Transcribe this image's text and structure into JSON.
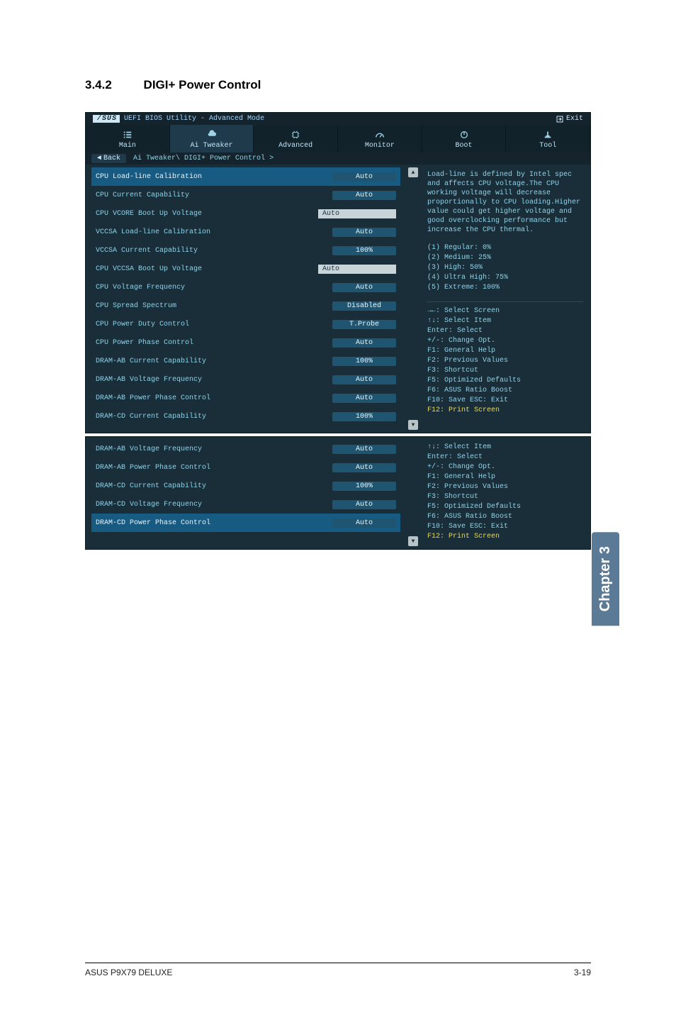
{
  "section": {
    "number": "3.4.2",
    "title": "DIGI+ Power Control"
  },
  "bios": {
    "title_brand": "/SUS",
    "title_rest": "UEFI BIOS Utility - Advanced Mode",
    "exit_label": "Exit",
    "tabs": [
      {
        "label": "Main",
        "icon": "list-icon"
      },
      {
        "label": "Ai Tweaker",
        "icon": "cloud-icon"
      },
      {
        "label": "Advanced",
        "icon": "chip-icon"
      },
      {
        "label": "Monitor",
        "icon": "gauge-icon"
      },
      {
        "label": "Boot",
        "icon": "power-icon"
      },
      {
        "label": "Tool",
        "icon": "tool-icon"
      }
    ],
    "back_label": "Back",
    "breadcrumb": "Ai Tweaker\\ DIGI+ Power Control >",
    "rows_top": [
      {
        "label": "CPU Load-line Calibration",
        "value": "Auto",
        "type": "btn",
        "selected": true
      },
      {
        "label": "CPU Current Capability",
        "value": "Auto",
        "type": "btn"
      },
      {
        "label": "CPU VCORE Boot Up Voltage",
        "value": "Auto",
        "type": "input"
      },
      {
        "label": "VCCSA Load-line Calibration",
        "value": "Auto",
        "type": "btn"
      },
      {
        "label": "VCCSA Current Capability",
        "value": "100%",
        "type": "btn"
      },
      {
        "label": "CPU VCCSA Boot Up Voltage",
        "value": "Auto",
        "type": "input"
      },
      {
        "label": "CPU Voltage Frequency",
        "value": "Auto",
        "type": "btn"
      },
      {
        "label": "CPU Spread Spectrum",
        "value": "Disabled",
        "type": "btn"
      },
      {
        "label": "CPU Power Duty Control",
        "value": "T.Probe",
        "type": "btn"
      },
      {
        "label": "CPU Power Phase Control",
        "value": "Auto",
        "type": "btn"
      },
      {
        "label": "DRAM-AB Current Capability",
        "value": "100%",
        "type": "btn"
      },
      {
        "label": "DRAM-AB Voltage Frequency",
        "value": "Auto",
        "type": "btn"
      },
      {
        "label": "DRAM-AB Power Phase Control",
        "value": "Auto",
        "type": "btn"
      },
      {
        "label": "DRAM-CD Current Capability",
        "value": "100%",
        "type": "btn"
      }
    ],
    "help_top": "Load-line is defined by Intel spec and affects CPU voltage.The CPU working voltage will decrease proportionally to CPU loading.Higher value could get higher voltage and good overclocking performance but increase the CPU thermal.",
    "help_list": [
      "(1) Regular: 0%",
      "(2) Medium: 25%",
      "(3) High: 50%",
      "(4) Ultra High: 75%",
      "(5) Extreme: 100%"
    ],
    "keys_top": [
      "→←: Select Screen",
      "↑↓: Select Item",
      "Enter: Select",
      "+/-: Change Opt.",
      "F1: General Help",
      "F2: Previous Values",
      "F3: Shortcut",
      "F5: Optimized Defaults",
      "F6: ASUS Ratio Boost",
      "F10: Save  ESC: Exit"
    ],
    "keys_top_highlight": "F12: Print Screen",
    "rows_bottom": [
      {
        "label": "DRAM-AB Voltage Frequency",
        "value": "Auto",
        "type": "btn"
      },
      {
        "label": "DRAM-AB Power Phase Control",
        "value": "Auto",
        "type": "btn"
      },
      {
        "label": "DRAM-CD Current Capability",
        "value": "100%",
        "type": "btn"
      },
      {
        "label": "DRAM-CD Voltage Frequency",
        "value": "Auto",
        "type": "btn"
      },
      {
        "label": "DRAM-CD Power Phase Control",
        "value": "Auto",
        "type": "btn",
        "selected": true
      }
    ],
    "keys_bottom": [
      "↑↓: Select Item",
      "Enter: Select",
      "+/-: Change Opt.",
      "F1: General Help",
      "F2: Previous Values",
      "F3: Shortcut",
      "F5: Optimized Defaults",
      "F6: ASUS Ratio Boost",
      "F10: Save  ESC: Exit"
    ],
    "keys_bottom_highlight": "F12: Print Screen"
  },
  "side_tab": "Chapter 3",
  "footer": {
    "left": "ASUS P9X79 DELUXE",
    "right": "3-19"
  }
}
